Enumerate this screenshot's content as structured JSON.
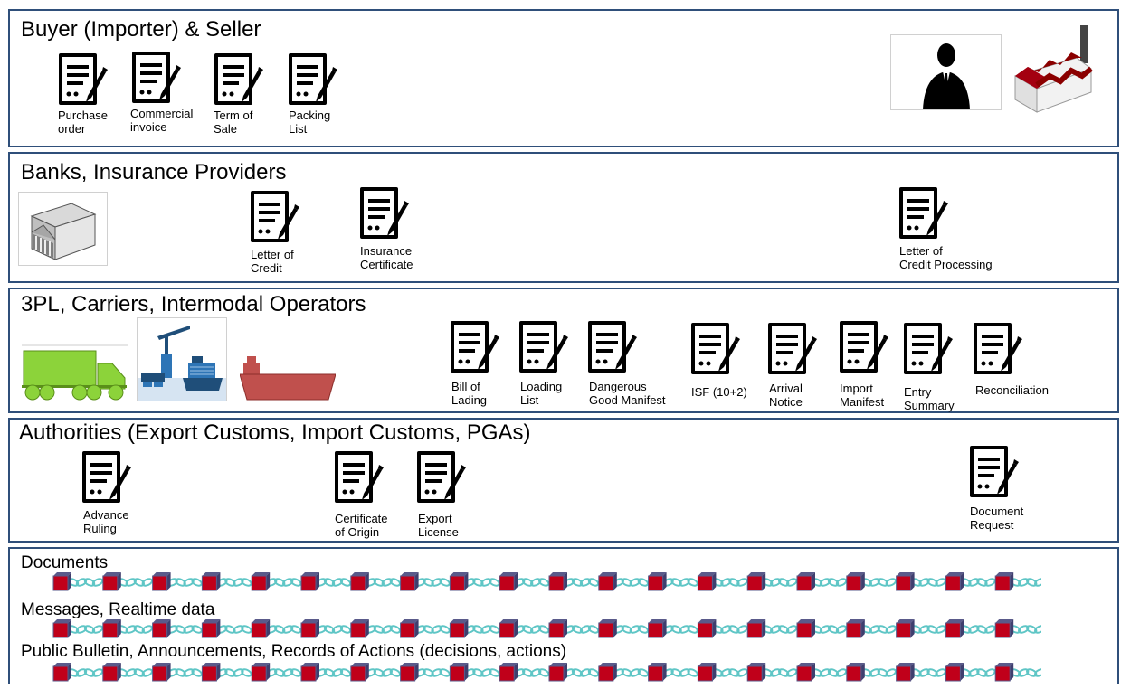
{
  "sections": [
    {
      "title": "Buyer (Importer) & Seller",
      "docs": [
        "Purchase\norder",
        "Commercial\ninvoice",
        "Term of\nSale",
        "Packing\nList"
      ]
    },
    {
      "title": "Banks, Insurance Providers",
      "docs": [
        "Letter of\nCredit",
        "Insurance\nCertificate",
        "Letter of\nCredit Processing"
      ]
    },
    {
      "title": "3PL, Carriers, Intermodal Operators",
      "docs": [
        "Bill of\nLading",
        "Loading\nList",
        "Dangerous\nGood Manifest",
        "ISF (10+2)",
        "Arrival\nNotice",
        "Import\nManifest",
        "Entry\nSummary",
        "Reconciliation"
      ]
    },
    {
      "title": "Authorities (Export Customs, Import Customs, PGAs)",
      "docs": [
        "Advance\nRuling",
        "Certificate\nof Origin",
        "Export\nLicense",
        "Document\nRequest"
      ]
    },
    {
      "title": "",
      "rows": [
        "Documents",
        "Messages, Realtime data",
        "Public Bulletin, Announcements, Records of Actions (decisions, actions)"
      ]
    }
  ],
  "icons": {
    "document": "document-edit-icon",
    "person": "businessman-icon",
    "factory": "factory-icon",
    "bank": "bank-building-icon",
    "truck": "truck-icon",
    "port": "port-crane-icon",
    "ship": "cargo-ship-icon",
    "block": "blockchain-block-icon"
  },
  "colors": {
    "border": "#2f4f7a",
    "block": "#c0001a",
    "chain": "#5fc6c6",
    "truck": "#8cd33a",
    "ship": "#c0504d"
  }
}
